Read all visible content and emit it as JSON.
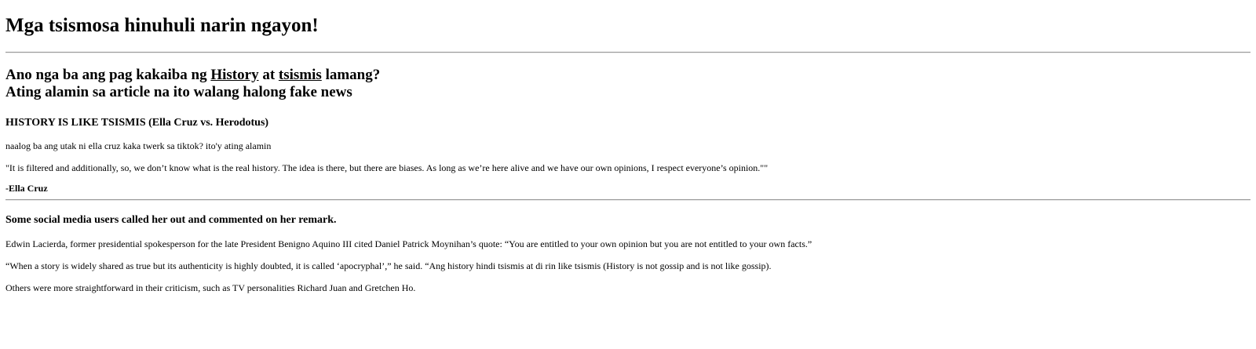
{
  "headline": "Mga tsismosa hinuhuli narin ngayon!",
  "subheading": {
    "part1": "Ano nga ba ang pag kakaiba ng ",
    "link_history": "History",
    "part2": " at ",
    "link_tsismis": "tsismis",
    "part3": " lamang?",
    "line2": "Ating alamin sa article na ito walang halong fake news"
  },
  "section1": {
    "title": "HISTORY IS LIKE TSISMIS (Ella Cruz vs. Herodotus)",
    "intro": "naalog ba ang utak ni ella cruz kaka twerk sa tiktok? ito'y ating alamin",
    "quote": "\"It is filtered and additionally, so, we don’t know what is the real history. The idea is there, but there are biases. As long as we’re here alive and we have our own opinions, I respect everyone’s opinion.\"\"",
    "author": "-Ella Cruz"
  },
  "section2": {
    "title": "Some social media users called her out and commented on her remark.",
    "p1": "Edwin Lacierda, former presidential spokesperson for the late President Benigno Aquino III cited Daniel Patrick Moynihan’s quote: “You are entitled to your own opinion but you are not entitled to your own facts.”",
    "p2": "“When a story is widely shared as true but its authenticity is highly doubted, it is called ‘apocryphal’,” he said. “Ang history hindi tsismis at di rin like tsismis (History is not gossip and is not like gossip).",
    "p3": "Others were more straightforward in their criticism, such as TV personalities Richard Juan and Gretchen Ho."
  }
}
